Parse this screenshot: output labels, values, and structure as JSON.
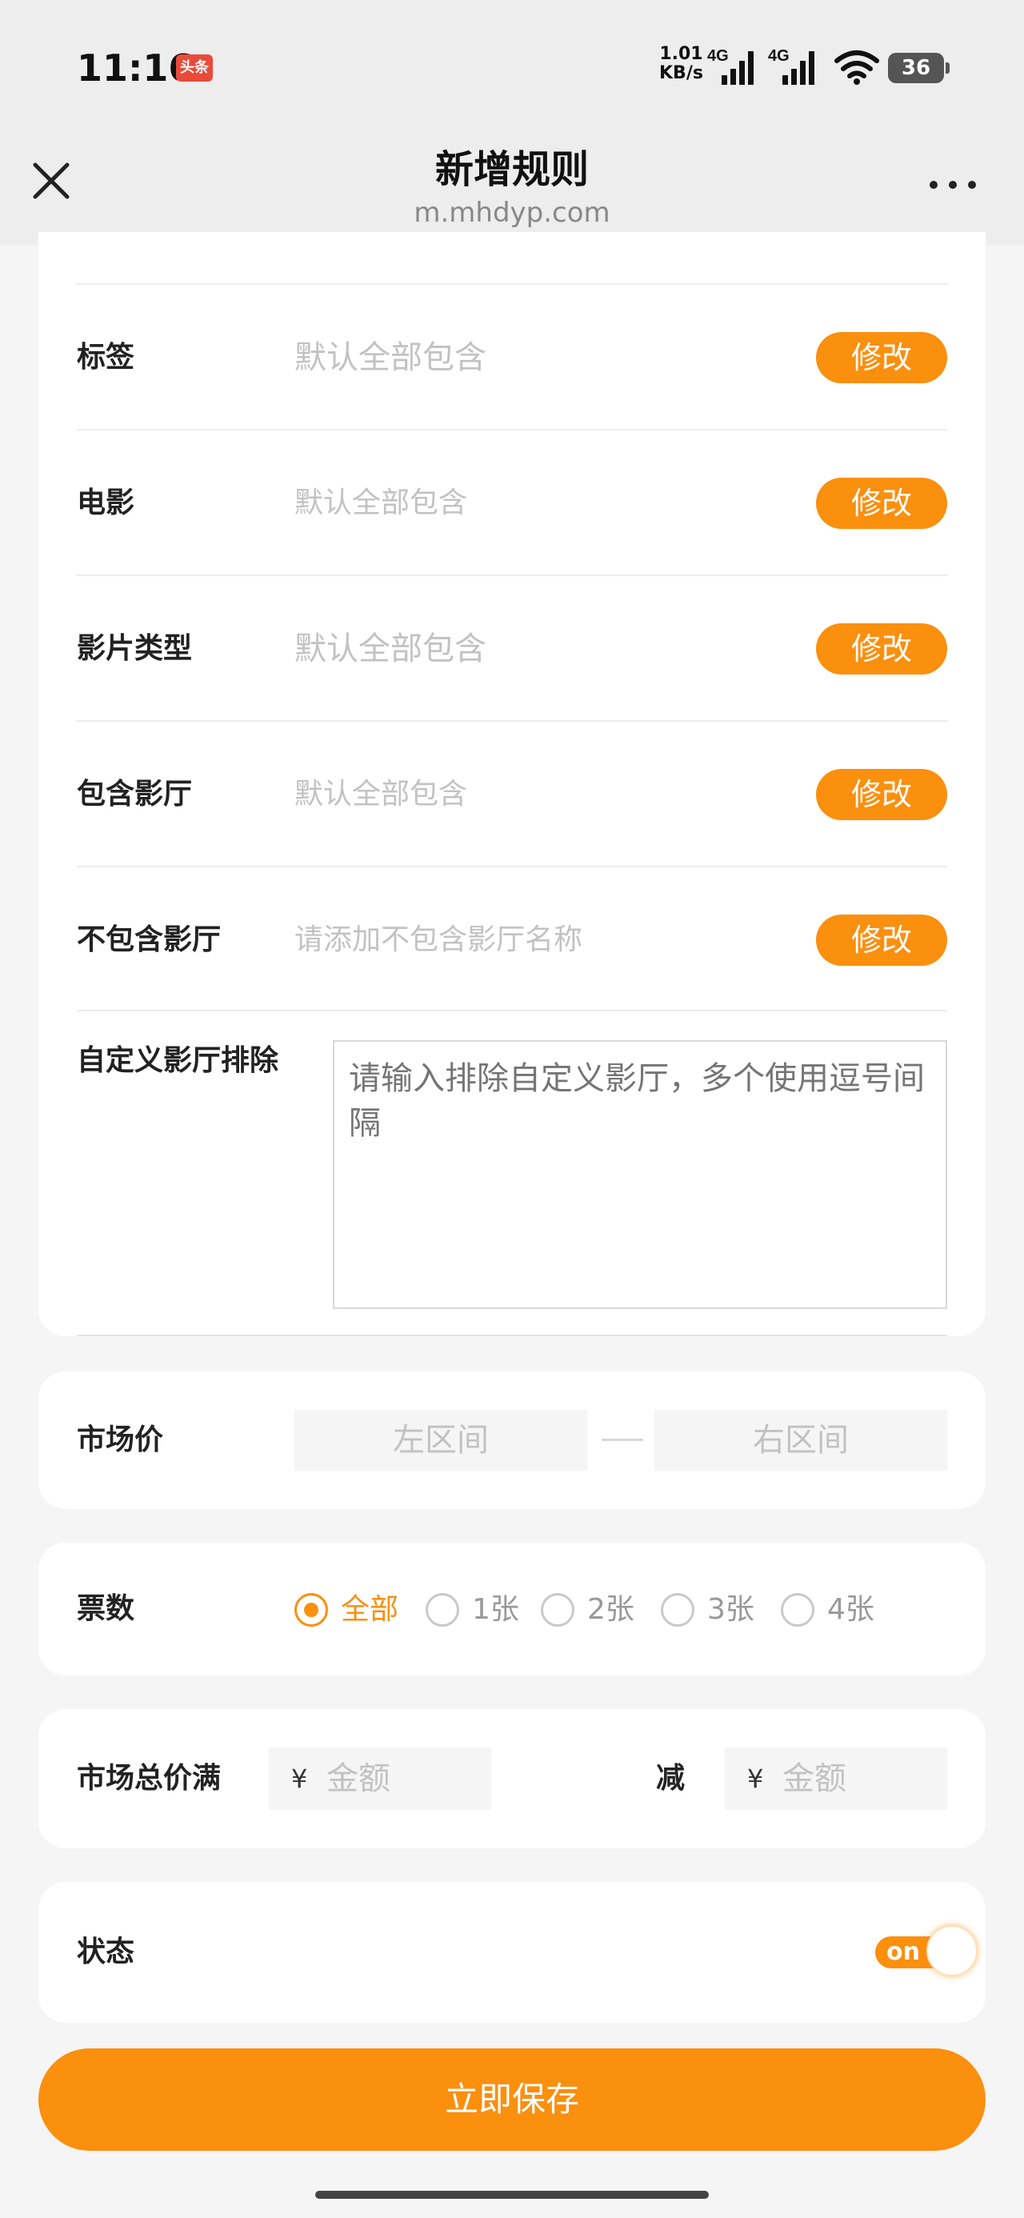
{
  "status_bar": {
    "time": "11:16",
    "app_badge": "头条",
    "net_speed_value": "1.01",
    "net_speed_unit": "KB/s",
    "signal1_label": "4G",
    "signal2_label": "4G",
    "battery": "36"
  },
  "header": {
    "title": "新增规则",
    "url": "m.mhdyp.com"
  },
  "rules": [
    {
      "label": "标签",
      "value": "默认全部包含",
      "button": "修改"
    },
    {
      "label": "电影",
      "value": "默认全部包含",
      "button": "修改"
    },
    {
      "label": "影片类型",
      "value": "默认全部包含",
      "button": "修改"
    },
    {
      "label": "包含影厅",
      "value": "默认全部包含",
      "button": "修改"
    },
    {
      "label": "不包含影厅",
      "value": "请添加不包含影厅名称",
      "button": "修改"
    }
  ],
  "custom_exclude": {
    "label": "自定义影厅排除",
    "placeholder": "请输入排除自定义影厅，多个使用逗号间隔"
  },
  "market_price": {
    "label": "市场价",
    "left_placeholder": "左区间",
    "right_placeholder": "右区间"
  },
  "ticket_count": {
    "label": "票数",
    "options": [
      "全部",
      "1张",
      "2张",
      "3张",
      "4张"
    ],
    "selected": "全部"
  },
  "discount": {
    "label": "市场总价满",
    "currency": "¥",
    "amount_placeholder": "金额",
    "minus_label": "减"
  },
  "status": {
    "label": "状态",
    "toggle_text": "on",
    "enabled": true
  },
  "save_button": "立即保存",
  "colors": {
    "accent": "#fb8f0e",
    "background": "#f5f5f5",
    "header_bg": "#ededed"
  }
}
